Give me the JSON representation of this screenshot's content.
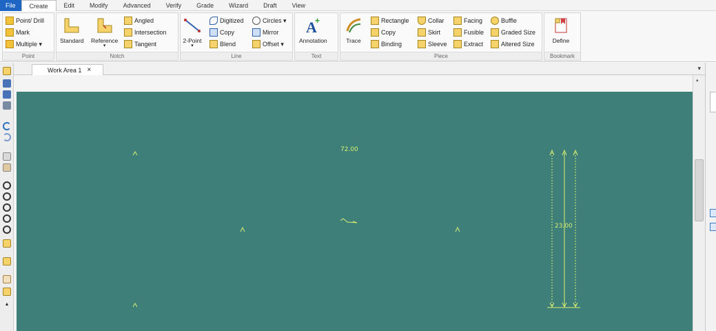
{
  "menu": {
    "items": [
      "File",
      "Create",
      "Edit",
      "Modify",
      "Advanced",
      "Verify",
      "Grade",
      "Wizard",
      "Draft",
      "View"
    ]
  },
  "ribbon": {
    "point": {
      "label": "Point",
      "point_drill": "Point/ Drill",
      "mark": "Mark",
      "multiple": "Multiple ▾"
    },
    "notch": {
      "label": "Notch",
      "standard": "Standard",
      "reference": "Reference",
      "angled": "Angled",
      "intersection": "Intersection",
      "tangent": "Tangent"
    },
    "line": {
      "label": "Line",
      "two_point": "2-Point",
      "digitized": "Digitized",
      "copy": "Copy",
      "blend": "Blend",
      "circles": "Circles ▾",
      "mirror": "Mirror",
      "offset": "Offset ▾"
    },
    "text": {
      "label": "Text",
      "annotation": "Annotation"
    },
    "piece": {
      "label": "Piece",
      "trace": "Trace",
      "rectangle": "Rectangle",
      "copy": "Copy",
      "binding": "Binding",
      "collar": "Collar",
      "skirt": "Skirt",
      "sleeve": "Sleeve",
      "facing": "Facing",
      "fusible": "Fusible",
      "extract": "Extract",
      "buffle": "Buffle",
      "graded_size": "Graded Size",
      "altered_size": "Altered Size"
    },
    "bookmark": {
      "label": "Bookmark",
      "define": "Define"
    }
  },
  "tabs": {
    "work_area": "Work Area 1",
    "close": "×",
    "dropdown": "▾"
  },
  "canvas": {
    "measure_top": "72.00",
    "measure_right": "23.00",
    "background_color": "#3e7f7a",
    "line_color": "#d8f070"
  }
}
